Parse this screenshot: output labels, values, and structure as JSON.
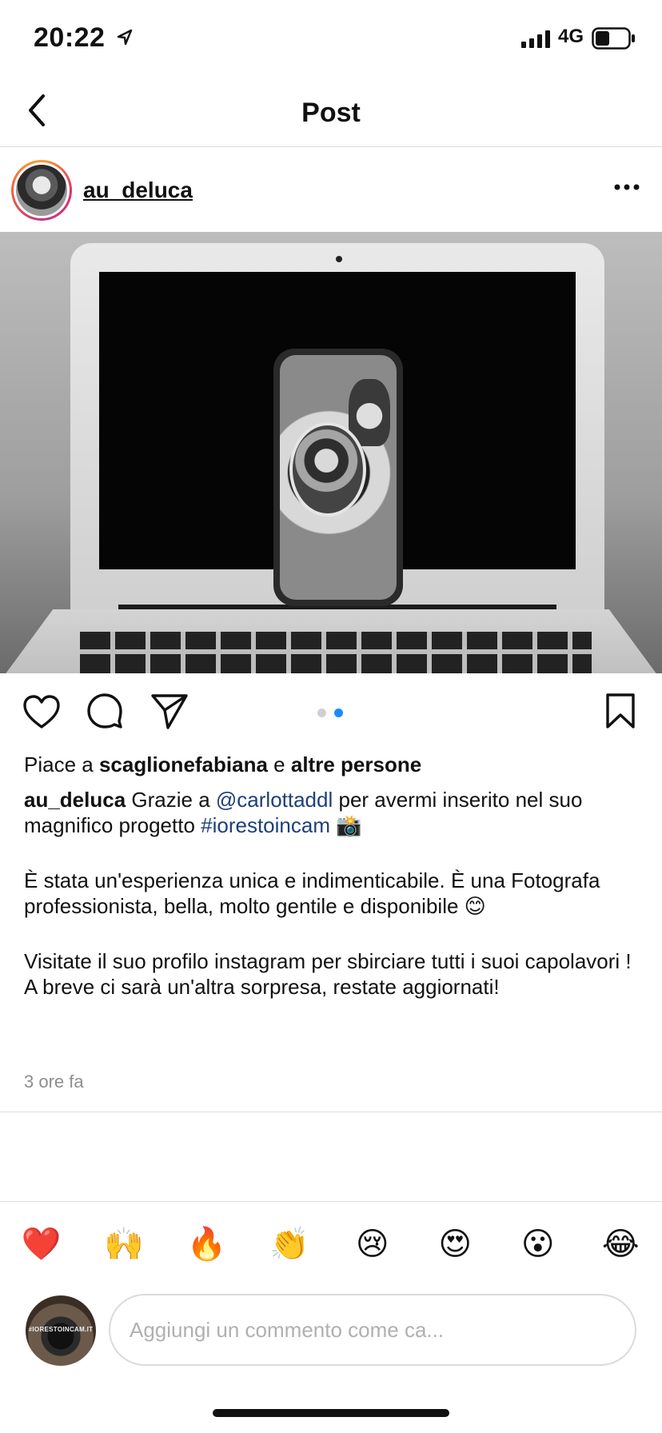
{
  "status_bar": {
    "time": "20:22",
    "network": "4G",
    "icons": [
      "location-arrow-icon",
      "signal-icon",
      "battery-icon"
    ]
  },
  "nav": {
    "title": "Post",
    "back_icon": "chevron-left-icon"
  },
  "post": {
    "username": "au_deluca",
    "more_icon": "ellipsis-icon",
    "carousel": {
      "total": 2,
      "active_index": 1,
      "active_color": "#1a8cff"
    },
    "likes": {
      "prefix": "Piace a",
      "user": "scaglionefabiana",
      "conj": "e",
      "others": "altre persone"
    },
    "caption": {
      "username": "au_deluca",
      "text1": "Grazie a",
      "mention": "@carlottaddl",
      "text2": "per avermi inserito nel suo magnifico progetto",
      "hashtag": "#iorestoincam",
      "emoji_camera": "📸",
      "paragraph2": "È stata un'esperienza unica e indimenticabile. È una Fotografa professionista, bella, molto gentile e disponibile",
      "emoji_smile": "😊",
      "paragraph3_line1": "Visitate il suo profilo instagram per sbirciare tutti i suoi capolavori !",
      "paragraph3_line2": "A breve ci sarà un'altra sorpresa, restate aggiornati!"
    },
    "time_ago": "3 ore fa"
  },
  "reactions": [
    "❤️",
    "🙌",
    "🔥",
    "👏",
    "😢",
    "😍",
    "😮",
    "😂"
  ],
  "composer": {
    "avatar_text": "#IORESTOINCAM.IT",
    "placeholder": "Aggiungi un commento come ca..."
  },
  "colors": {
    "link": "#1d3f7a",
    "muted": "#8e8e8e",
    "divider": "#dcdcdc"
  }
}
